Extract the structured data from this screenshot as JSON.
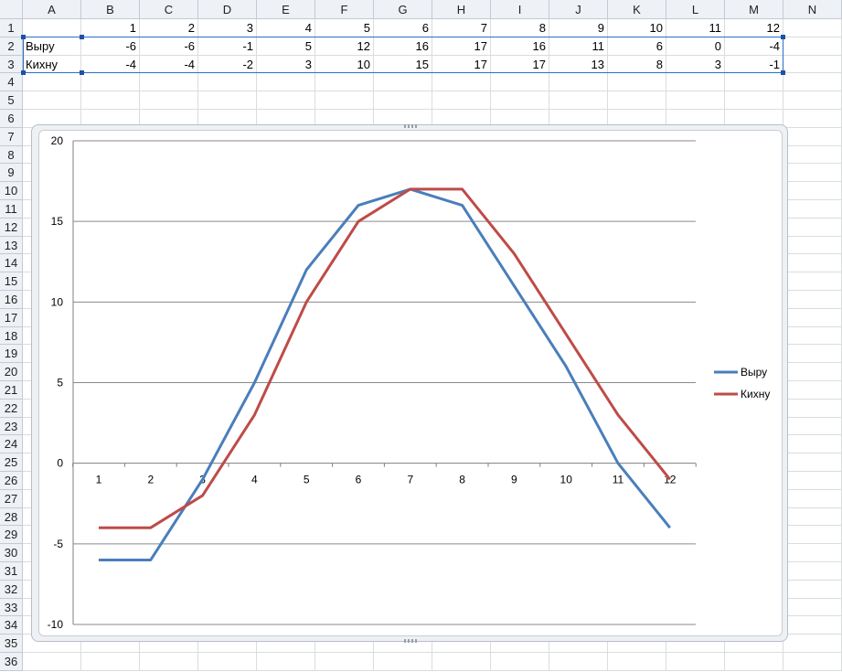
{
  "sheet": {
    "columns": [
      "A",
      "B",
      "C",
      "D",
      "E",
      "F",
      "G",
      "H",
      "I",
      "J",
      "K",
      "L",
      "M",
      "N"
    ],
    "rows": [
      "1",
      "2",
      "3",
      "4",
      "5",
      "6",
      "7",
      "8",
      "9",
      "10",
      "11",
      "12",
      "13",
      "14",
      "15",
      "16",
      "17",
      "18",
      "19",
      "20",
      "21",
      "22",
      "23",
      "24",
      "25",
      "26",
      "27",
      "28",
      "29",
      "30",
      "31",
      "32",
      "33",
      "34",
      "35",
      "36"
    ],
    "data_rows": [
      {
        "label": "",
        "values": [
          "1",
          "2",
          "3",
          "4",
          "5",
          "6",
          "7",
          "8",
          "9",
          "10",
          "11",
          "12"
        ]
      },
      {
        "label": "Выру",
        "values": [
          "-6",
          "-6",
          "-1",
          "5",
          "12",
          "16",
          "17",
          "16",
          "11",
          "6",
          "0",
          "-4"
        ]
      },
      {
        "label": "Кихну",
        "values": [
          "-4",
          "-4",
          "-2",
          "3",
          "10",
          "15",
          "17",
          "17",
          "13",
          "8",
          "3",
          "-1"
        ]
      }
    ]
  },
  "chart_data": {
    "type": "line",
    "categories": [
      "1",
      "2",
      "3",
      "4",
      "5",
      "6",
      "7",
      "8",
      "9",
      "10",
      "11",
      "12"
    ],
    "series": [
      {
        "name": "Выру",
        "values": [
          -6,
          -6,
          -1,
          5,
          12,
          16,
          17,
          16,
          11,
          6,
          0,
          -4
        ],
        "color": "#4a7ebb"
      },
      {
        "name": "Кихну",
        "values": [
          -4,
          -4,
          -2,
          3,
          10,
          15,
          17,
          17,
          13,
          8,
          3,
          -1
        ],
        "color": "#be4b48"
      }
    ],
    "ylim": [
      -10,
      20
    ],
    "yticks": [
      "20",
      "15",
      "10",
      "5",
      "0",
      "-5",
      "-10"
    ],
    "grid": true,
    "legend": "right"
  }
}
